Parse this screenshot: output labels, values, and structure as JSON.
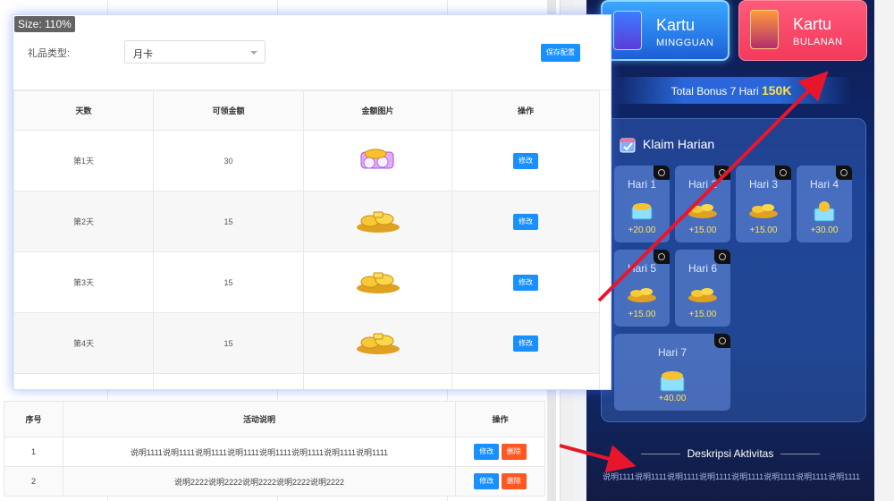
{
  "overlay": {
    "size_label": "Size: 110%"
  },
  "modal": {
    "gift_type_label": "礼品类型:",
    "gift_type_value": "月卡",
    "save_label": "保存配置",
    "columns": [
      "天数",
      "可领金额",
      "金额图片",
      "操作"
    ],
    "rows": [
      {
        "day": "第1天",
        "amount": "30",
        "action": "修改"
      },
      {
        "day": "第2天",
        "amount": "15",
        "action": "修改"
      },
      {
        "day": "第3天",
        "amount": "15",
        "action": "修改"
      },
      {
        "day": "第4天",
        "amount": "15",
        "action": "修改"
      }
    ]
  },
  "activity_table": {
    "columns": [
      "序号",
      "活动说明",
      "操作"
    ],
    "rows": [
      {
        "no": "1",
        "desc": "说明1111说明1111说明1111说明1111说明1111说明1111说明1111说明1111",
        "edit": "修改",
        "delete": "删除"
      },
      {
        "no": "2",
        "desc": "说明2222说明2222说明2222说明2222说明2222",
        "edit": "修改",
        "delete": "删除"
      }
    ]
  },
  "game": {
    "tabs": [
      {
        "title": "Kartu",
        "sub": "MINGGUAN"
      },
      {
        "title": "Kartu",
        "sub": "BULANAN"
      }
    ],
    "bonus_prefix": "Total Bonus 7 Hari",
    "bonus_amount": "150K",
    "claim_title": "Klaim Harian",
    "days": [
      {
        "label": "Hari 1",
        "value": "+20.00"
      },
      {
        "label": "Hari 2",
        "value": "+15.00"
      },
      {
        "label": "Hari 3",
        "value": "+15.00"
      },
      {
        "label": "Hari 4",
        "value": "+30.00"
      },
      {
        "label": "Hari 5",
        "value": "+15.00"
      },
      {
        "label": "Hari 6",
        "value": "+15.00"
      },
      {
        "label": "Hari 7",
        "value": "+40.00"
      }
    ],
    "desc_title": "Deskripsi Aktivitas",
    "desc_text": "说明1111说明1111说明1111说明1111说明1111说明1111说明1111说明1111"
  },
  "colors": {
    "primary_button": "#1890ff",
    "danger_button": "#ff5722",
    "arrow": "#e8162c",
    "bonus_amount": "#ffe04a"
  }
}
